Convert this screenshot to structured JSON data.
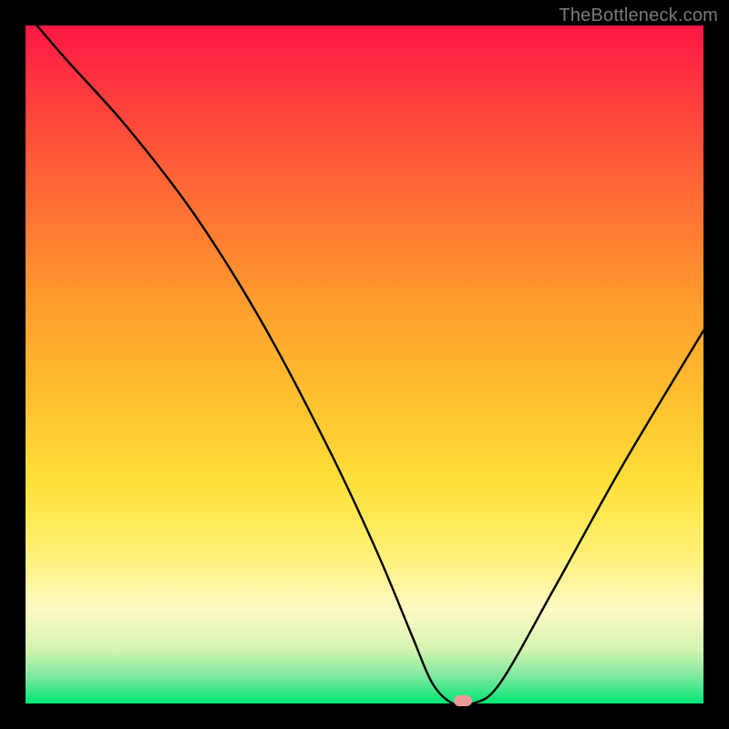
{
  "watermark": "TheBottleneck.com",
  "chart_data": {
    "type": "line",
    "title": "",
    "xlabel": "",
    "ylabel": "",
    "xlim": [
      0,
      100
    ],
    "ylim": [
      0,
      100
    ],
    "x": [
      0,
      6,
      15,
      25,
      35,
      45,
      52,
      57,
      60,
      63,
      66,
      70,
      78,
      88,
      100
    ],
    "values": [
      102,
      95,
      85,
      72,
      56,
      37,
      22,
      10,
      3,
      0,
      0,
      3,
      17,
      35,
      55
    ],
    "grid": false,
    "marker": {
      "x": 64.5,
      "y": 0
    },
    "gradient_colors": {
      "top": "#ff1744",
      "mid_high": "#ff6b35",
      "mid": "#ffc02e",
      "mid_low": "#fff176",
      "low": "#00e676"
    }
  }
}
